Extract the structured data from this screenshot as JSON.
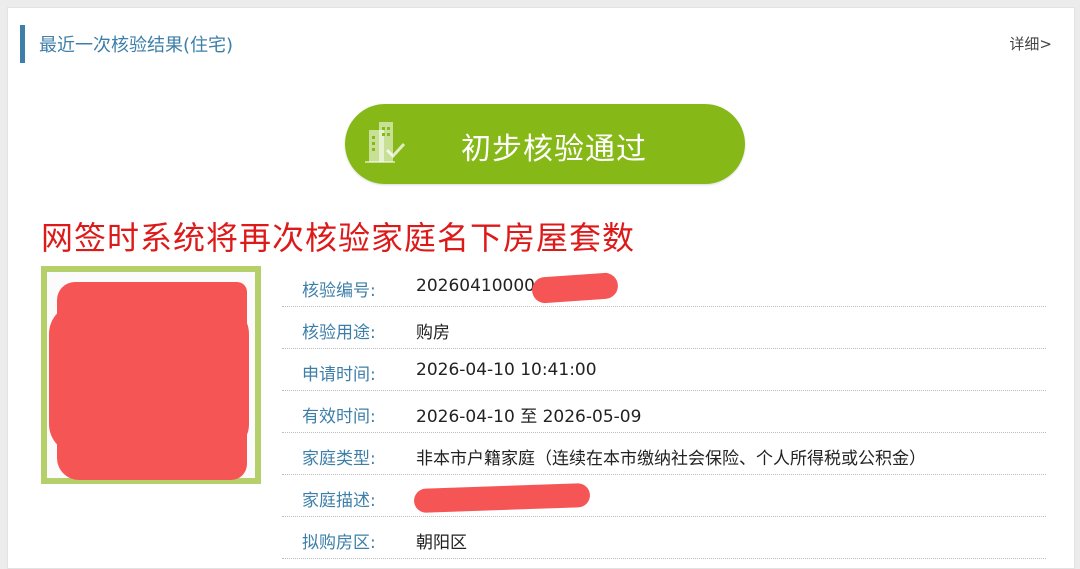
{
  "header": {
    "title": "最近一次核验结果(住宅)",
    "detail_link": "详细>"
  },
  "status_button": {
    "label": "初步核验通过",
    "icon": "building-check-icon"
  },
  "notice": "网签时系统将再次核验家庭名下房屋套数",
  "details": [
    {
      "label": "核验编号:",
      "value": "2026041000002"
    },
    {
      "label": "核验用途:",
      "value": "购房"
    },
    {
      "label": "申请时间:",
      "value": "2026-04-10 10:41:00"
    },
    {
      "label": "有效时间:",
      "value": "2026-04-10 至 2026-05-09"
    },
    {
      "label": "家庭类型:",
      "value": "非本市户籍家庭（连续在本市缴纳社会保险、个人所得税或公积金）"
    },
    {
      "label": "家庭描述:",
      "value": ""
    },
    {
      "label": "拟购房区:",
      "value": "朝阳区"
    }
  ],
  "colors": {
    "accent": "#3d7fa8",
    "pass_green": "#86b817",
    "notice_red": "#dd1a1a",
    "photo_border": "#b5cf6a",
    "redaction": "#f65555"
  }
}
